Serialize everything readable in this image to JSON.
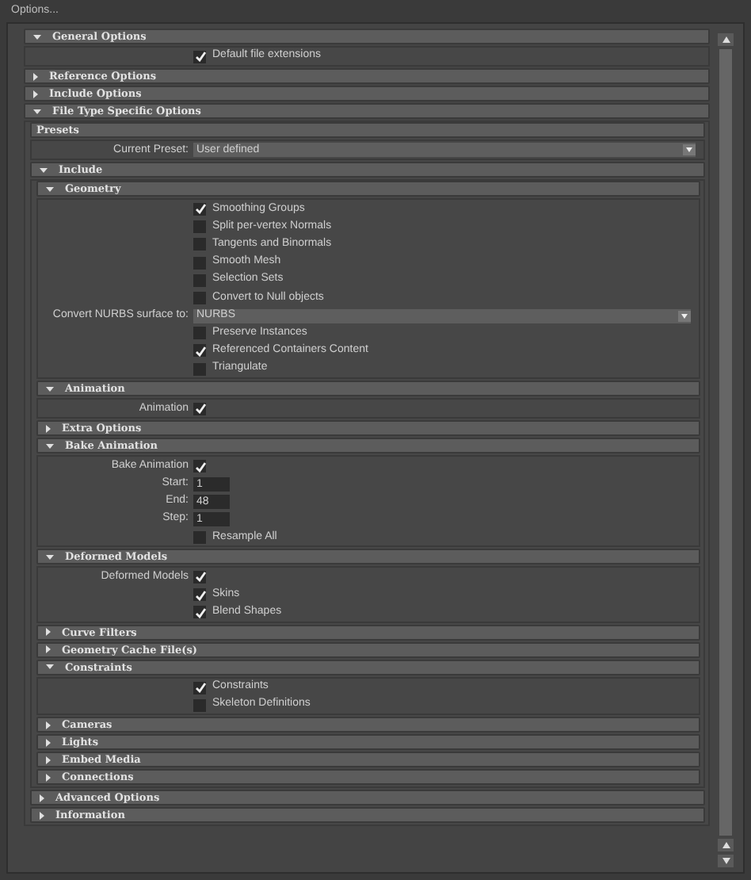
{
  "window": {
    "title": "Options..."
  },
  "sections": [
    {
      "kind": "section",
      "title": "General Options",
      "expanded": true,
      "items": [
        {
          "kind": "checkbox",
          "label": "Default file extensions",
          "checked": true
        }
      ]
    },
    {
      "kind": "section",
      "title": "Reference Options",
      "expanded": false
    },
    {
      "kind": "section",
      "title": "Include Options",
      "expanded": false
    },
    {
      "kind": "section",
      "title": "File Type Specific Options",
      "expanded": true,
      "items": [
        {
          "kind": "group",
          "title": "Presets",
          "items": [
            {
              "kind": "dropdown",
              "label": "Current Preset:",
              "value": "User defined"
            }
          ]
        },
        {
          "kind": "section",
          "title": "Include",
          "expanded": true,
          "items": [
            {
              "kind": "section",
              "title": "Geometry",
              "expanded": true,
              "items": [
                {
                  "kind": "checkbox",
                  "label": "Smoothing Groups",
                  "checked": true
                },
                {
                  "kind": "checkbox",
                  "label": "Split per-vertex Normals",
                  "checked": false
                },
                {
                  "kind": "checkbox",
                  "label": "Tangents and Binormals",
                  "checked": false
                },
                {
                  "kind": "checkbox",
                  "label": "Smooth Mesh",
                  "checked": false
                },
                {
                  "kind": "checkbox",
                  "label": "Selection Sets",
                  "checked": false
                },
                {
                  "kind": "checkbox",
                  "label": "Convert to Null objects",
                  "checked": false
                },
                {
                  "kind": "dropdown",
                  "label": "Convert NURBS surface to:",
                  "value": "NURBS"
                },
                {
                  "kind": "checkbox",
                  "label": "Preserve Instances",
                  "checked": false
                },
                {
                  "kind": "checkbox",
                  "label": "Referenced Containers Content",
                  "checked": true
                },
                {
                  "kind": "checkbox",
                  "label": "Triangulate",
                  "checked": false
                }
              ]
            },
            {
              "kind": "section",
              "title": "Animation",
              "expanded": true,
              "items": [
                {
                  "kind": "labeled-checkbox",
                  "label": "Animation",
                  "checked": true
                }
              ]
            },
            {
              "kind": "section",
              "title": "Extra Options",
              "expanded": false
            },
            {
              "kind": "section",
              "title": "Bake Animation",
              "expanded": true,
              "items": [
                {
                  "kind": "labeled-checkbox",
                  "label": "Bake Animation",
                  "checked": true
                },
                {
                  "kind": "number",
                  "label": "Start:",
                  "value": "1"
                },
                {
                  "kind": "number",
                  "label": "End:",
                  "value": "48"
                },
                {
                  "kind": "number",
                  "label": "Step:",
                  "value": "1"
                },
                {
                  "kind": "checkbox",
                  "label": "Resample All",
                  "checked": false
                }
              ]
            },
            {
              "kind": "section",
              "title": "Deformed Models",
              "expanded": true,
              "items": [
                {
                  "kind": "labeled-checkbox",
                  "label": "Deformed Models",
                  "checked": true
                },
                {
                  "kind": "checkbox",
                  "label": "Skins",
                  "checked": true
                },
                {
                  "kind": "checkbox",
                  "label": "Blend Shapes",
                  "checked": true
                }
              ]
            },
            {
              "kind": "section",
              "title": "Curve Filters",
              "expanded": false
            },
            {
              "kind": "section",
              "title": "Geometry Cache File(s)",
              "expanded": false
            },
            {
              "kind": "section",
              "title": "Constraints",
              "expanded": true,
              "items": [
                {
                  "kind": "checkbox",
                  "label": "Constraints",
                  "checked": true
                },
                {
                  "kind": "checkbox",
                  "label": "Skeleton Definitions",
                  "checked": false
                }
              ]
            },
            {
              "kind": "section",
              "title": "Cameras",
              "expanded": false
            },
            {
              "kind": "section",
              "title": "Lights",
              "expanded": false
            },
            {
              "kind": "section",
              "title": "Embed Media",
              "expanded": false
            },
            {
              "kind": "section",
              "title": "Connections",
              "expanded": false
            }
          ]
        },
        {
          "kind": "section",
          "title": "Advanced Options",
          "expanded": false
        },
        {
          "kind": "section",
          "title": "Information",
          "expanded": false
        }
      ]
    }
  ]
}
